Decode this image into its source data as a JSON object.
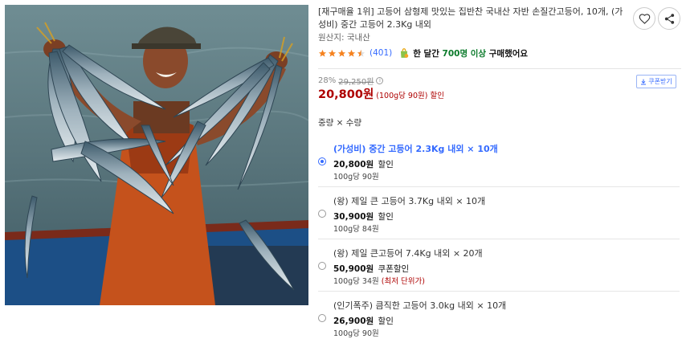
{
  "product": {
    "title": "[재구매율 1위] 고등어 삼형제 맛있는 집반찬 국내산 자반 손질간고등어, 10개, (가성비) 중간 고등어 2.3Kg 내외",
    "origin": "원산지: 국내산",
    "rating_stars": 4.5,
    "review_count": "(401)",
    "buyers_prefix": "한 달간",
    "buyers_highlight": "700명 이상",
    "buyers_suffix": "구매했어요"
  },
  "icons": {
    "wishlist": "heart-icon",
    "share": "share-icon",
    "coupon": "download-icon",
    "bag": "shopping-bag-icon",
    "info": "info-icon"
  },
  "price": {
    "discount_pct": "28%",
    "original": "29,250원",
    "info_glyph": "i",
    "final": "20,800원",
    "unit_note": "(100g당 90원) 할인"
  },
  "coupon_label": "쿠폰받기",
  "option_label": "중량 × 수량",
  "options": [
    {
      "name": "(가성비) 중간 고등어 2.3Kg 내외 × 10개",
      "price": "20,800원",
      "tag": "할인",
      "unit": "100g당 90원",
      "best": "",
      "selected": true
    },
    {
      "name": "(왕) 제일 큰 고등어 3.7Kg 내외 × 10개",
      "price": "30,900원",
      "tag": "할인",
      "unit": "100g당 84원",
      "best": "",
      "selected": false
    },
    {
      "name": "(왕) 제일 큰고등어 7.4Kg 내외 × 20개",
      "price": "50,900원",
      "tag": "쿠폰할인",
      "unit": "100g당 34원",
      "best": "(최저 단위가)",
      "selected": false
    },
    {
      "name": "(인기폭주) 큼직한 고등어 3.0kg 내외 × 10개",
      "price": "26,900원",
      "tag": "할인",
      "unit": "100g당 90원",
      "best": "",
      "selected": false
    }
  ],
  "colors": {
    "accent": "#346aff",
    "price_red": "#ae0000",
    "star": "#f5821f",
    "buyers_green": "#0a7a2a"
  }
}
